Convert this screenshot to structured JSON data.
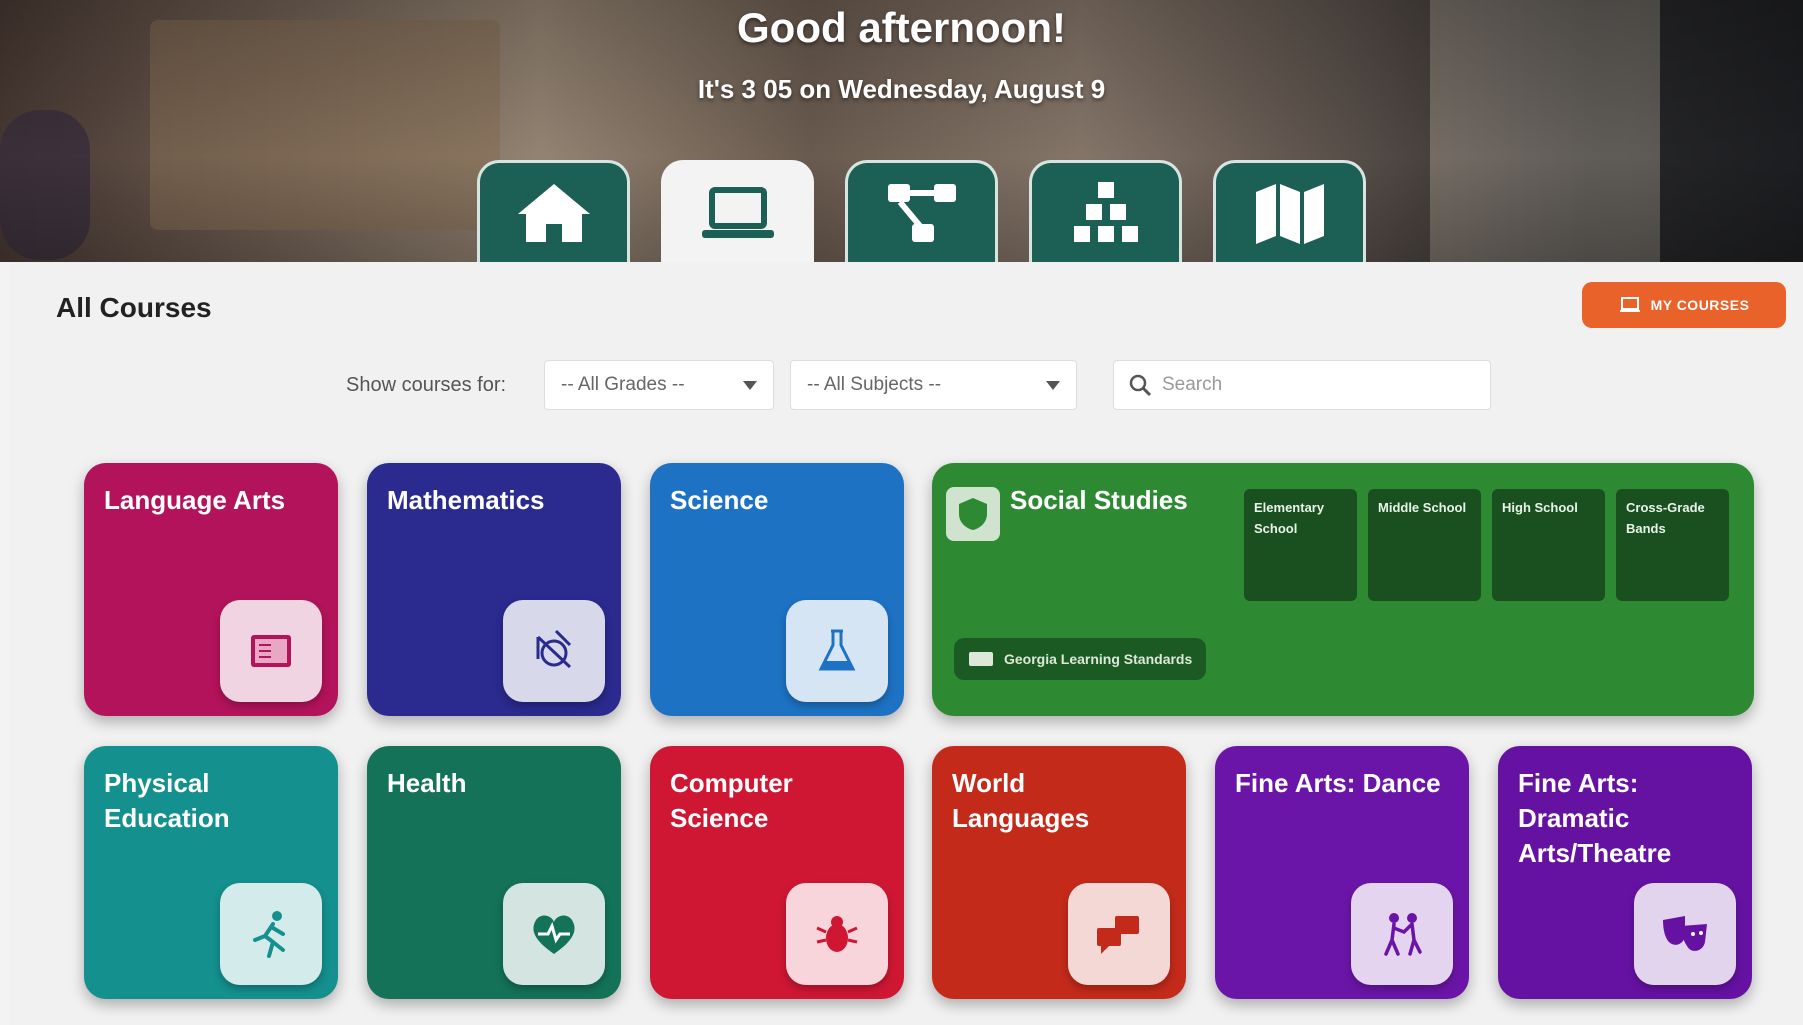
{
  "header": {
    "greeting": "Good afternoon!",
    "datetime": "It's 3 05 on Wednesday, August 9"
  },
  "nav_tabs": [
    {
      "icon": "home-icon",
      "active": false
    },
    {
      "icon": "laptop-icon",
      "active": true
    },
    {
      "icon": "network-icon",
      "active": false
    },
    {
      "icon": "hierarchy-icon",
      "active": false
    },
    {
      "icon": "map-icon",
      "active": false
    }
  ],
  "main": {
    "title": "All Courses",
    "my_courses_label": "MY COURSES"
  },
  "filters": {
    "label": "Show courses for:",
    "grades": "-- All Grades --",
    "subjects": "-- All Subjects --",
    "search_placeholder": "Search"
  },
  "courses": [
    {
      "name": "Language Arts",
      "color": "#b3135a",
      "icon": "book-icon"
    },
    {
      "name": "Mathematics",
      "color": "#2a2a8f",
      "icon": "geometry-icon"
    },
    {
      "name": "Science",
      "color": "#1d72c4",
      "icon": "flask-icon"
    },
    {
      "name": "Social Studies",
      "color": "#2d8a33",
      "icon": "shield-icon",
      "sub_levels": [
        "Elementary School",
        "Middle School",
        "High School",
        "Cross-Grade Bands"
      ],
      "standards_label": "Georgia Learning Standards"
    },
    {
      "name": "Physical Education",
      "color": "#14908e",
      "icon": "running-icon"
    },
    {
      "name": "Health",
      "color": "#137258",
      "icon": "heart-pulse-icon"
    },
    {
      "name": "Computer Science",
      "color": "#cf1733",
      "icon": "bug-icon"
    },
    {
      "name": "World Languages",
      "color": "#c42a1a",
      "icon": "chat-translate-icon"
    },
    {
      "name": "Fine Arts: Dance",
      "color": "#6b15a8",
      "icon": "dance-icon"
    },
    {
      "name": "Fine Arts: Dramatic Arts/Theatre",
      "color": "#6512a3",
      "icon": "theater-masks-icon"
    }
  ]
}
